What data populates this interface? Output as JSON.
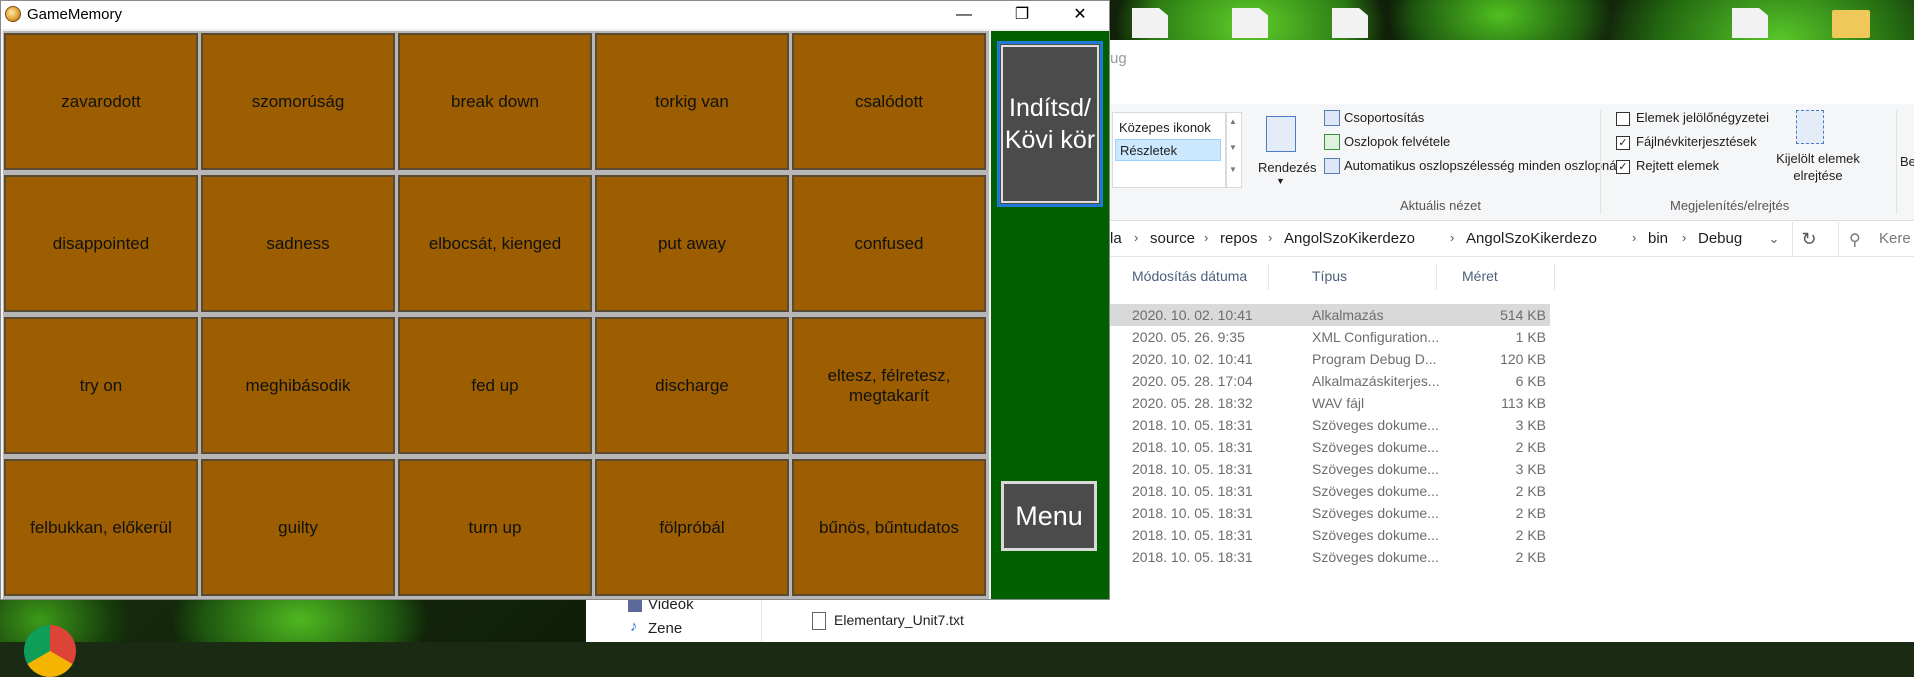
{
  "window": {
    "title": "GameMemory",
    "minimize_glyph": "—",
    "maximize_glyph": "❐",
    "close_glyph": "✕"
  },
  "cards": [
    [
      "zavarodott",
      "szomorúság",
      "break down",
      "torkig van",
      "csalódott"
    ],
    [
      "disappointed",
      "sadness",
      "elbocsát, kienged",
      "put away",
      "confused"
    ],
    [
      "try on",
      "meghibásodik",
      "fed up",
      "discharge",
      "eltesz, félretesz, megtakarít"
    ],
    [
      "felbukkan, előkerül",
      "guilty",
      "turn up",
      "fölpróbál",
      "bűnös, bűntudatos"
    ]
  ],
  "side": {
    "start_label": "Indítsd/ Kövi kör",
    "menu_label": "Menu"
  },
  "explorer": {
    "address_fragment": "ug",
    "view_items": [
      "Közepes ikonok",
      "Részletek"
    ],
    "rendezes": "Rendezés",
    "csoportositas": "Csoportosítás",
    "oszlopok": "Oszlopok felvétele",
    "auto_width": "Automatikus oszlopszélesség minden oszlopnál",
    "aktualis_nezet": "Aktuális nézet",
    "chk_elemek": "Elemek jelölőnégyzetei",
    "chk_kiterjesztes": "Fájlnévkiterjesztések",
    "chk_rejtett": "Rejtett elemek",
    "kijelolt": "Kijelölt elemek elrejtése",
    "megjelenites": "Megjelenítés/elrejtés",
    "be_fragment": "Be",
    "path": [
      "la",
      "source",
      "repos",
      "AngolSzoKikerdezo",
      "AngolSzoKikerdezo",
      "bin",
      "Debug"
    ],
    "search_placeholder": "Kere",
    "columns": [
      "Módosítás dátuma",
      "Típus",
      "Méret"
    ],
    "rows": [
      [
        "2020. 10. 02. 10:41",
        "Alkalmazás",
        "514 KB"
      ],
      [
        "2020. 05. 26. 9:35",
        "XML Configuration...",
        "1 KB"
      ],
      [
        "2020. 10. 02. 10:41",
        "Program Debug D...",
        "120 KB"
      ],
      [
        "2020. 05. 28. 17:04",
        "Alkalmazáskiterjes...",
        "6 KB"
      ],
      [
        "2020. 05. 28. 18:32",
        "WAV fájl",
        "113 KB"
      ],
      [
        "2018. 10. 05. 18:31",
        "Szöveges dokume...",
        "3 KB"
      ],
      [
        "2018. 10. 05. 18:31",
        "Szöveges dokume...",
        "2 KB"
      ],
      [
        "2018. 10. 05. 18:31",
        "Szöveges dokume...",
        "3 KB"
      ],
      [
        "2018. 10. 05. 18:31",
        "Szöveges dokume...",
        "2 KB"
      ],
      [
        "2018. 10. 05. 18:31",
        "Szöveges dokume...",
        "2 KB"
      ],
      [
        "2018. 10. 05. 18:31",
        "Szöveges dokume...",
        "2 KB"
      ],
      [
        "2018. 10. 05. 18:31",
        "Szöveges dokume...",
        "2 KB"
      ]
    ],
    "nav_items": [
      "Videók",
      "Zene"
    ],
    "bottom_file": "Elementary_Unit7.txt"
  }
}
